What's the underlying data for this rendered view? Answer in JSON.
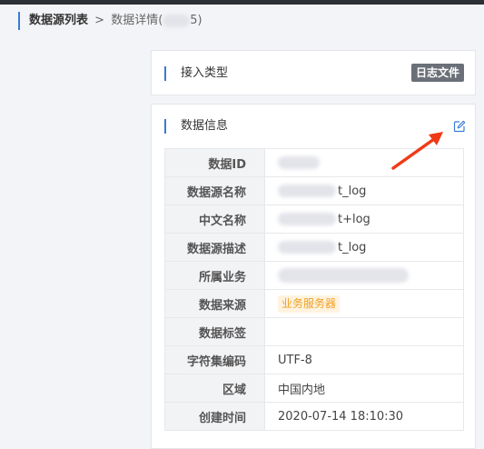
{
  "breadcrumb": {
    "current": "数据源列表",
    "separator": ">",
    "detail_prefix": "数据详情(",
    "detail_suffix": "5)"
  },
  "access_card": {
    "title": "接入类型",
    "type_tag": "日志文件"
  },
  "info_card": {
    "title": "数据信息",
    "rows": [
      {
        "key": "数据ID",
        "value": ""
      },
      {
        "key": "数据源名称",
        "value": "t_log"
      },
      {
        "key": "中文名称",
        "value": "t+log"
      },
      {
        "key": "数据源描述",
        "value": "t_log"
      },
      {
        "key": "所属业务",
        "value": ""
      },
      {
        "key": "数据来源",
        "tag": "业务服务器"
      },
      {
        "key": "数据标签",
        "value": ""
      },
      {
        "key": "字符集编码",
        "value": "UTF-8"
      },
      {
        "key": "区域",
        "value": "中国内地"
      },
      {
        "key": "创建时间",
        "value": "2020-07-14 18:10:30"
      }
    ]
  },
  "colors": {
    "accent": "#3a7bd5",
    "arrow": "#f03a17",
    "tag_orange": "#f0a020",
    "tag_dark": "#6b6f77"
  },
  "icons": {
    "edit": "edit-icon"
  }
}
